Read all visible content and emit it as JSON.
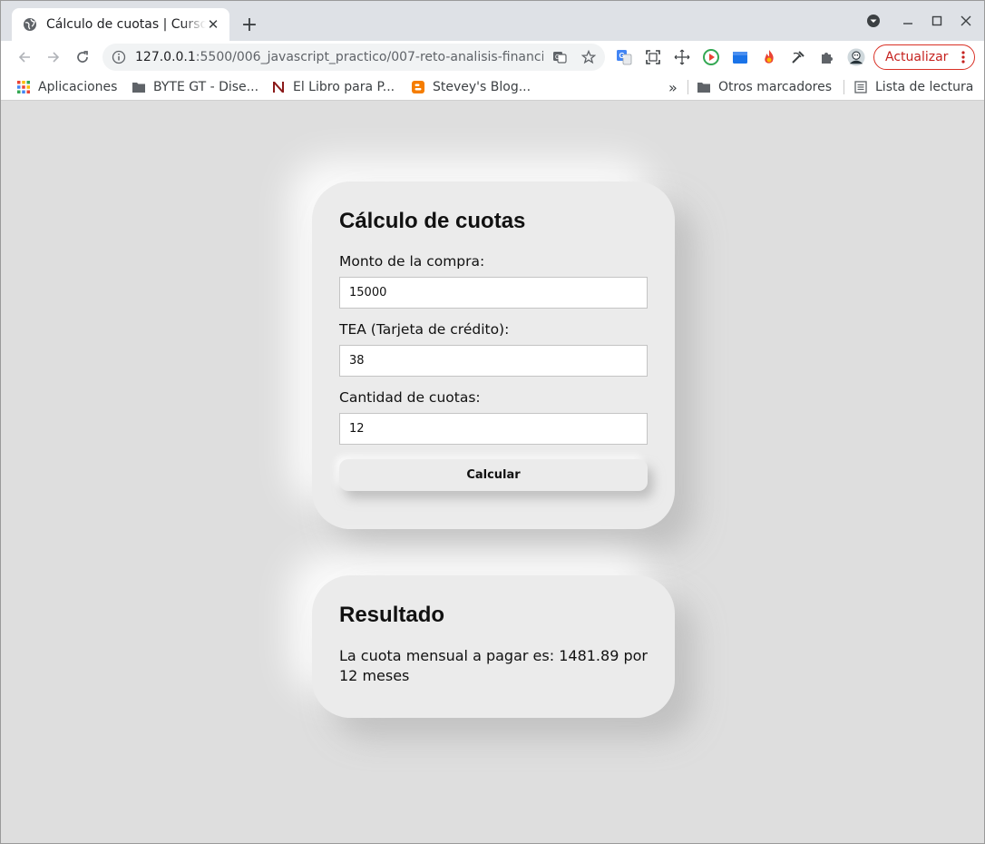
{
  "browser": {
    "tab_title": "Cálculo de cuotas | Curso de Prá",
    "url_host": "127.0.0.1",
    "url_path": ":5500/006_javascript_practico/007-reto-analisis-financiero/...",
    "update_label": "Actualizar"
  },
  "bookmarks": [
    {
      "label": "Aplicaciones",
      "icon": "apps-grid-icon"
    },
    {
      "label": "BYTE GT - Dise...",
      "icon": "folder-icon"
    },
    {
      "label": "El Libro para P...",
      "icon": "n-logo-icon"
    },
    {
      "label": "Stevey's Blog...",
      "icon": "blogger-icon"
    }
  ],
  "bookmarks_more": "»",
  "bookmarks_other": "Otros marcadores",
  "reading_list": "Lista de lectura",
  "form": {
    "title": "Cálculo de cuotas",
    "monto_label": "Monto de la compra:",
    "monto_value": "15000",
    "tea_label": "TEA (Tarjeta de crédito):",
    "tea_value": "38",
    "cuotas_label": "Cantidad de cuotas:",
    "cuotas_value": "12",
    "button_label": "Calcular"
  },
  "result": {
    "title": "Resultado",
    "text": "La cuota mensual a pagar es: 1481.89 por 12 meses"
  },
  "colors": {
    "page_bg": "#dedede",
    "card_bg": "#ebebeb",
    "update_accent": "#d93025"
  }
}
